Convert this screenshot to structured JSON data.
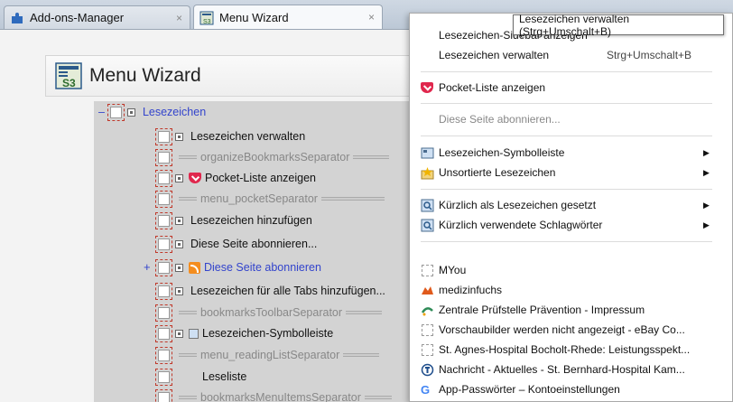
{
  "tabs": [
    {
      "label": "Add-ons-Manager",
      "close": "×"
    },
    {
      "label": "Menu Wizard",
      "close": "×"
    }
  ],
  "wizard": {
    "title": "Menu Wizard",
    "icon_text": "S3"
  },
  "tree": {
    "root": {
      "expander": "–",
      "label": "Lesezeichen"
    },
    "items": [
      {
        "label": "Lesezeichen verwalten"
      },
      {
        "label": "organizeBookmarksSeparator"
      },
      {
        "label": "Pocket-Liste anzeigen"
      },
      {
        "label": "menu_pocketSeparator"
      },
      {
        "label": "Lesezeichen hinzufügen"
      },
      {
        "label": "Diese Seite abonnieren..."
      },
      {
        "label": "Diese Seite abonnieren",
        "expander": "+"
      },
      {
        "label": "Lesezeichen für alle Tabs hinzufügen..."
      },
      {
        "label": "bookmarksToolbarSeparator"
      },
      {
        "label": "Lesezeichen-Symbolleiste"
      },
      {
        "label": "menu_readingListSeparator"
      },
      {
        "label": "Leseliste"
      },
      {
        "label": "bookmarksMenuItemsSeparator"
      }
    ]
  },
  "tooltip": "Lesezeichen verwalten (Strg+Umschalt+B)",
  "menu": {
    "sidebar": "Lesezeichen-Sidebar anzeigen",
    "manage": "Lesezeichen verwalten",
    "manage_shortcut": "Strg+Umschalt+B",
    "pocket": "Pocket-Liste anzeigen",
    "subscribe": "Diese Seite abonnieren...",
    "toolbar": "Lesezeichen-Symbolleiste",
    "unsorted": "Unsortierte Lesezeichen",
    "recent": "Kürzlich als Lesezeichen gesetzt",
    "tags": "Kürzlich verwendete Schlagwörter",
    "submenu_arrow": "▶",
    "bookmarks": [
      "MYou",
      "medizinfuchs",
      "Zentrale Prüfstelle Prävention - Impressum",
      "Vorschaubilder werden nicht angezeigt - eBay Co...",
      "St. Agnes-Hospital Bocholt-Rhede: Leistungsspekt...",
      "Nachricht - Aktuelles - St. Bernhard-Hospital Kam...",
      "App-Passwörter – Kontoeinstellungen"
    ],
    "google_glyph": "G"
  },
  "colors": {
    "accent": "#3344cc",
    "pocket": "#e0274d",
    "rss": "#f48d1f"
  }
}
